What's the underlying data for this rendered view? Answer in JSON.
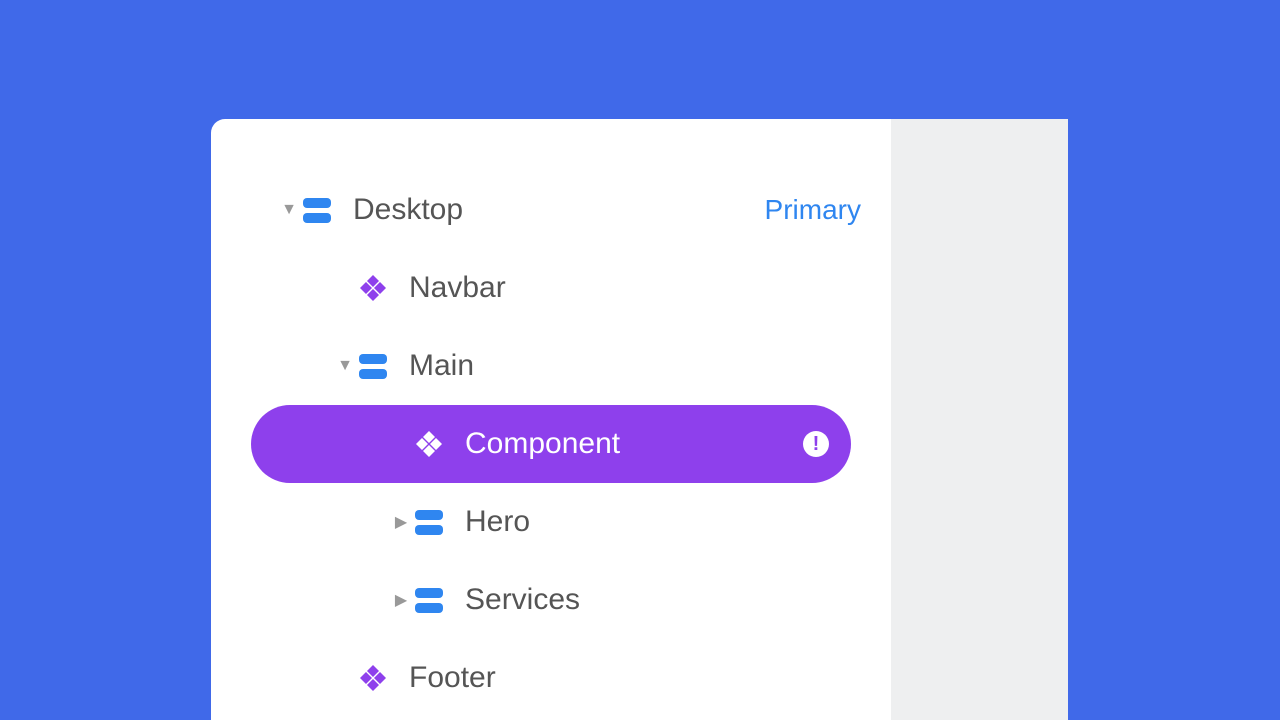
{
  "tree": {
    "desktop": {
      "label": "Desktop",
      "badge": "Primary"
    },
    "navbar": {
      "label": "Navbar"
    },
    "main": {
      "label": "Main"
    },
    "component": {
      "label": "Component"
    },
    "hero": {
      "label": "Hero"
    },
    "services": {
      "label": "Services"
    },
    "footer": {
      "label": "Footer"
    }
  },
  "colors": {
    "accent_purple": "#8e40ec",
    "accent_blue": "#2f86f0",
    "page_bg": "#4069e9"
  }
}
